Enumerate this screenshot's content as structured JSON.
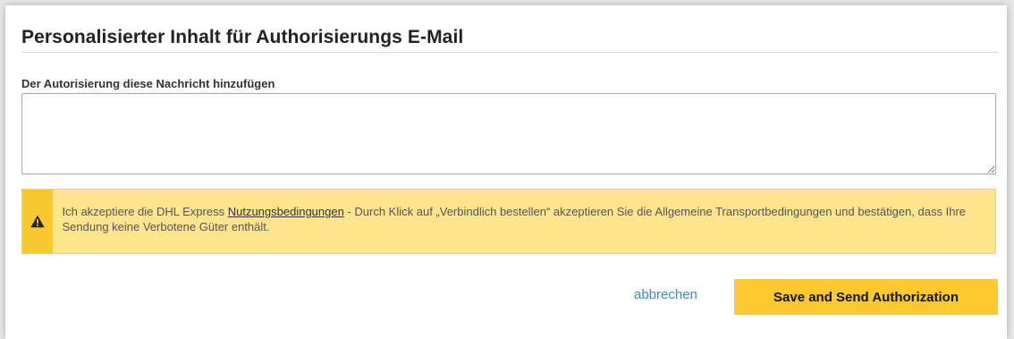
{
  "form": {
    "title": "Personalisierter Inhalt für Authorisierungs E-Mail",
    "message_label": "Der Autorisierung diese Nachricht hinzufügen",
    "message_value": ""
  },
  "notice": {
    "icon": "warning-icon",
    "text_before_link": "Ich akzeptiere die DHL Express ",
    "link_text": "Nutzungsbedingungen",
    "text_after_link": " - Durch Klick auf „Verbindlich bestellen“ akzeptieren Sie die Allgemeine Transportbedingungen und bestätigen, dass Ihre Sendung keine Verbotene Güter enthält."
  },
  "actions": {
    "cancel_label": "abbrechen",
    "submit_label": "Save and Send Authorization"
  },
  "colors": {
    "notice_background": "#fde58e",
    "notice_icon_background": "#f6c92f",
    "button_background": "#fdc92f",
    "link_color": "#3a8bc9"
  }
}
